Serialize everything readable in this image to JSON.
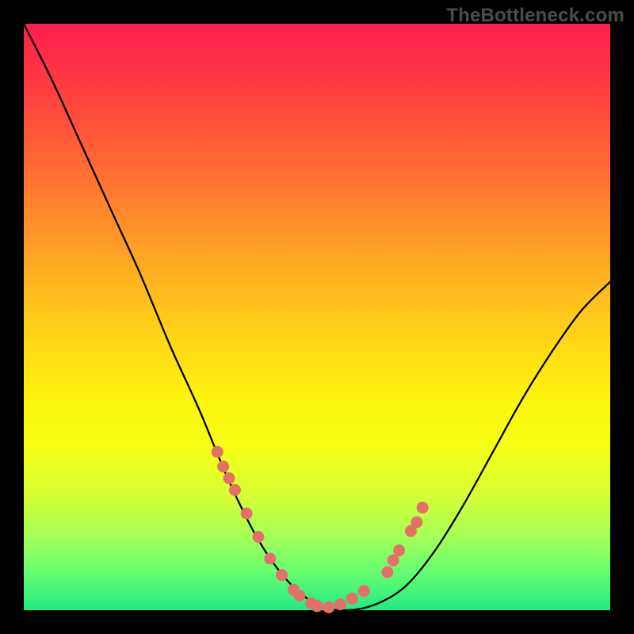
{
  "watermark": "TheBottleneck.com",
  "chart_data": {
    "type": "line",
    "title": "",
    "xlabel": "",
    "ylabel": "",
    "xlim": [
      0,
      1
    ],
    "ylim": [
      0,
      1
    ],
    "series": [
      {
        "name": "bottleneck-curve",
        "x": [
          0.0,
          0.05,
          0.1,
          0.15,
          0.2,
          0.25,
          0.3,
          0.35,
          0.4,
          0.45,
          0.5,
          0.55,
          0.6,
          0.65,
          0.7,
          0.75,
          0.8,
          0.85,
          0.9,
          0.95,
          1.0
        ],
        "y": [
          1.0,
          0.9,
          0.79,
          0.68,
          0.57,
          0.45,
          0.34,
          0.22,
          0.12,
          0.05,
          0.01,
          0.0,
          0.01,
          0.04,
          0.1,
          0.18,
          0.27,
          0.36,
          0.44,
          0.51,
          0.56
        ]
      }
    ],
    "highlighted_points": {
      "name": "salmon-dots",
      "color": "#e37168",
      "x": [
        0.33,
        0.34,
        0.35,
        0.36,
        0.38,
        0.4,
        0.42,
        0.44,
        0.46,
        0.47,
        0.49,
        0.5,
        0.52,
        0.54,
        0.56,
        0.58,
        0.62,
        0.63,
        0.64,
        0.66,
        0.67,
        0.68
      ],
      "y": [
        0.27,
        0.245,
        0.225,
        0.205,
        0.165,
        0.125,
        0.088,
        0.06,
        0.035,
        0.025,
        0.012,
        0.007,
        0.005,
        0.01,
        0.02,
        0.033,
        0.065,
        0.085,
        0.102,
        0.135,
        0.15,
        0.175
      ]
    }
  }
}
